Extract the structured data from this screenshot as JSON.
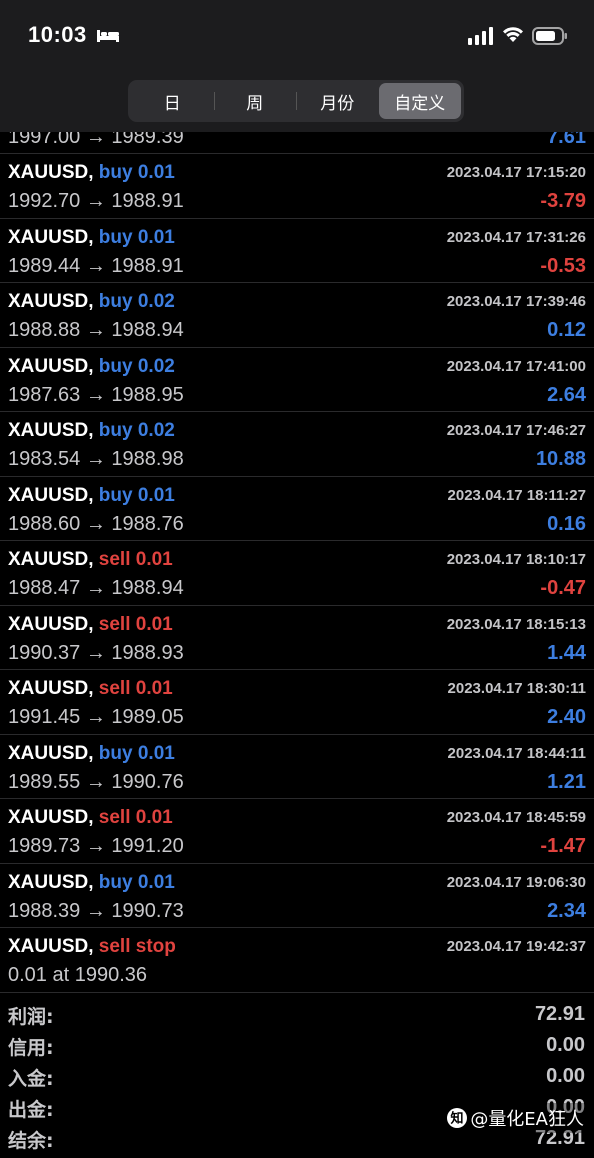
{
  "status_bar": {
    "time": "10:03"
  },
  "tabs": [
    {
      "label": "日",
      "active": false
    },
    {
      "label": "周",
      "active": false
    },
    {
      "label": "月份",
      "active": false
    },
    {
      "label": "自定义",
      "active": true
    }
  ],
  "deals": [
    {
      "symbol": "XAUUSD,",
      "side": "buy 0.01",
      "side_type": "buy",
      "time": "2023.04.17 17:15:20",
      "prices": "1992.70 → 1988.91",
      "profit": "-3.79",
      "profit_sign": "neg"
    },
    {
      "symbol": "XAUUSD,",
      "side": "buy 0.01",
      "side_type": "buy",
      "time": "2023.04.17 17:31:26",
      "prices": "1989.44 → 1988.91",
      "profit": "-0.53",
      "profit_sign": "neg"
    },
    {
      "symbol": "XAUUSD,",
      "side": "buy 0.02",
      "side_type": "buy",
      "time": "2023.04.17 17:39:46",
      "prices": "1988.88 → 1988.94",
      "profit": "0.12",
      "profit_sign": "pos"
    },
    {
      "symbol": "XAUUSD,",
      "side": "buy 0.02",
      "side_type": "buy",
      "time": "2023.04.17 17:41:00",
      "prices": "1987.63 → 1988.95",
      "profit": "2.64",
      "profit_sign": "pos"
    },
    {
      "symbol": "XAUUSD,",
      "side": "buy 0.02",
      "side_type": "buy",
      "time": "2023.04.17 17:46:27",
      "prices": "1983.54 → 1988.98",
      "profit": "10.88",
      "profit_sign": "pos"
    },
    {
      "symbol": "XAUUSD,",
      "side": "buy 0.01",
      "side_type": "buy",
      "time": "2023.04.17 18:11:27",
      "prices": "1988.60 → 1988.76",
      "profit": "0.16",
      "profit_sign": "pos"
    },
    {
      "symbol": "XAUUSD,",
      "side": "sell 0.01",
      "side_type": "sell",
      "time": "2023.04.17 18:10:17",
      "prices": "1988.47 → 1988.94",
      "profit": "-0.47",
      "profit_sign": "neg"
    },
    {
      "symbol": "XAUUSD,",
      "side": "sell 0.01",
      "side_type": "sell",
      "time": "2023.04.17 18:15:13",
      "prices": "1990.37 → 1988.93",
      "profit": "1.44",
      "profit_sign": "pos"
    },
    {
      "symbol": "XAUUSD,",
      "side": "sell 0.01",
      "side_type": "sell",
      "time": "2023.04.17 18:30:11",
      "prices": "1991.45 → 1989.05",
      "profit": "2.40",
      "profit_sign": "pos"
    },
    {
      "symbol": "XAUUSD,",
      "side": "buy 0.01",
      "side_type": "buy",
      "time": "2023.04.17 18:44:11",
      "prices": "1989.55 → 1990.76",
      "profit": "1.21",
      "profit_sign": "pos"
    },
    {
      "symbol": "XAUUSD,",
      "side": "sell 0.01",
      "side_type": "sell",
      "time": "2023.04.17 18:45:59",
      "prices": "1989.73 → 1991.20",
      "profit": "-1.47",
      "profit_sign": "neg"
    },
    {
      "symbol": "XAUUSD,",
      "side": "buy 0.01",
      "side_type": "buy",
      "time": "2023.04.17 19:06:30",
      "prices": "1988.39 → 1990.73",
      "profit": "2.34",
      "profit_sign": "pos"
    },
    {
      "symbol": "XAUUSD,",
      "side": "sell stop",
      "side_type": "sell",
      "time": "2023.04.17 19:42:37",
      "prices": "0.01 at 1990.36",
      "profit": "",
      "profit_sign": "pos"
    }
  ],
  "partial_row": {
    "prices": "1997.00 → 1989.39",
    "profit": "7.61"
  },
  "summary": [
    {
      "label": "利润:",
      "value": "72.91"
    },
    {
      "label": "信用:",
      "value": "0.00"
    },
    {
      "label": "入金:",
      "value": "0.00"
    },
    {
      "label": "出金:",
      "value": "0.00"
    },
    {
      "label": "结余:",
      "value": "72.91"
    }
  ],
  "watermark": {
    "text": "@量化EA狂人",
    "icon": "zhihu-icon"
  },
  "colors": {
    "buy": "#3d7ee0",
    "sell": "#e0433f",
    "background": "#000000",
    "header": "#1c1c1e"
  }
}
